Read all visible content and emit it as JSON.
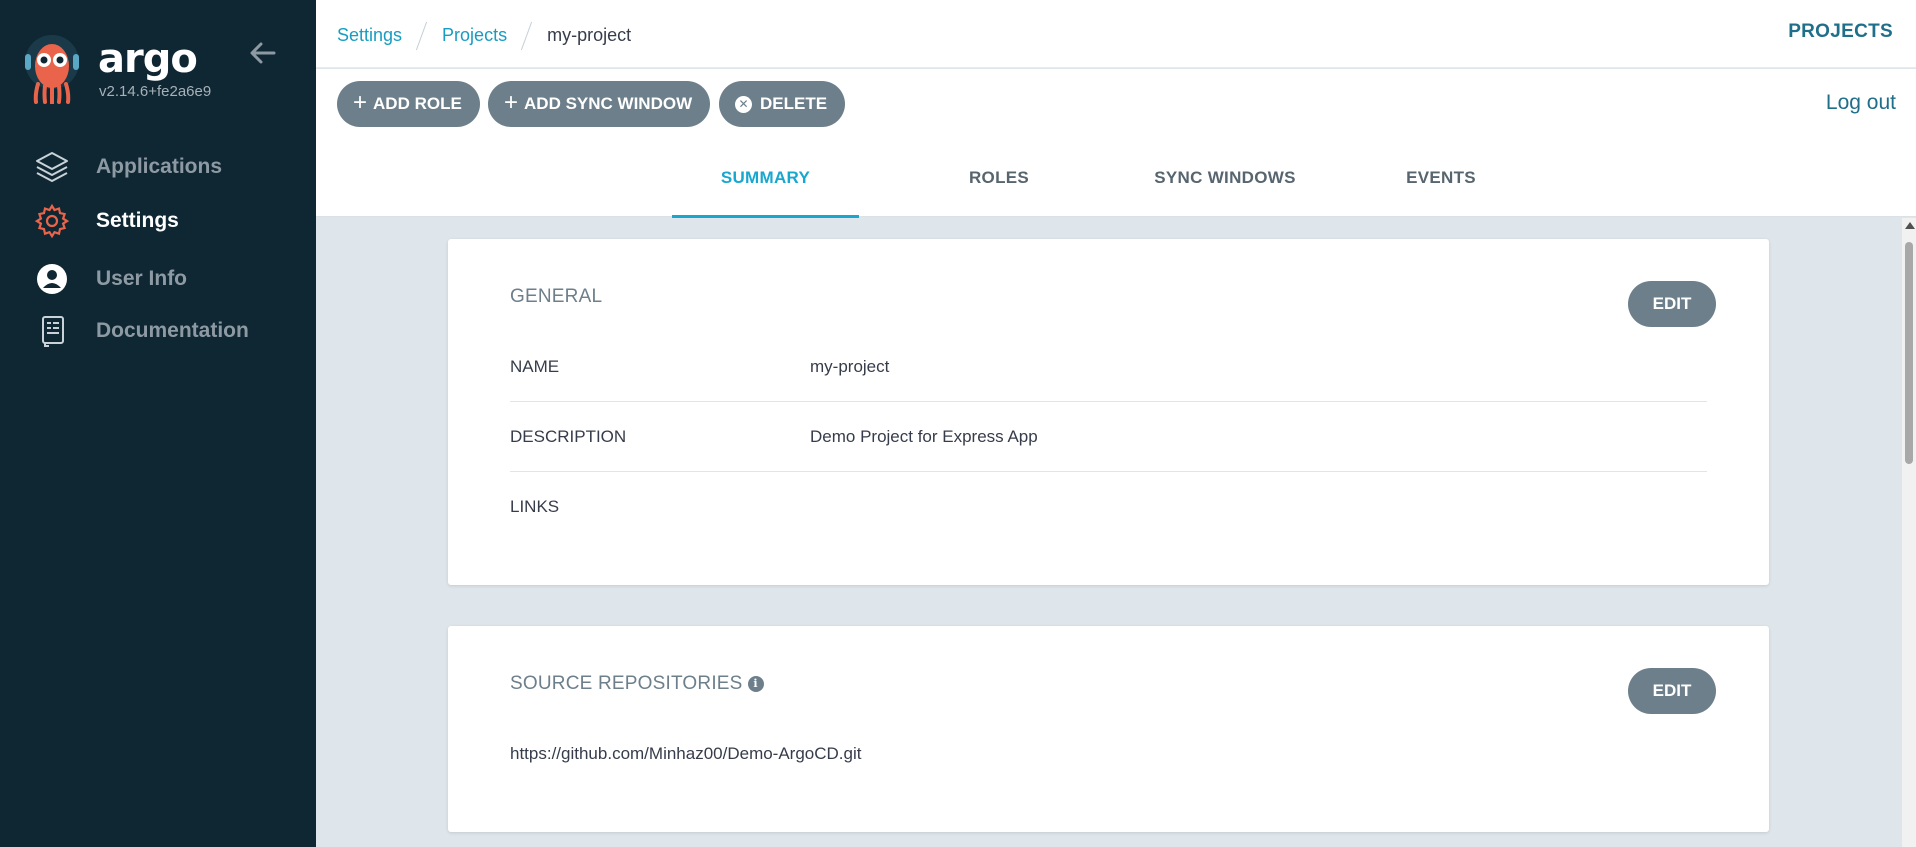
{
  "app": {
    "brand": "argo",
    "version": "v2.14.6+fe2a6e9"
  },
  "sidebar": {
    "items": [
      {
        "label": "Applications",
        "icon": "layers-icon"
      },
      {
        "label": "Settings",
        "icon": "gear-icon",
        "active": true
      },
      {
        "label": "User Info",
        "icon": "user-circle-icon"
      },
      {
        "label": "Documentation",
        "icon": "book-icon"
      }
    ]
  },
  "breadcrumb": {
    "items": [
      "Settings",
      "Projects"
    ],
    "current": "my-project"
  },
  "header": {
    "section": "PROJECTS",
    "logout": "Log out"
  },
  "toolbar": {
    "add_role": "ADD ROLE",
    "add_sync_window": "ADD SYNC WINDOW",
    "delete": "DELETE"
  },
  "tabs": [
    {
      "label": "SUMMARY",
      "active": true
    },
    {
      "label": "ROLES"
    },
    {
      "label": "SYNC WINDOWS"
    },
    {
      "label": "EVENTS"
    }
  ],
  "general": {
    "title": "GENERAL",
    "edit": "EDIT",
    "rows": [
      {
        "key": "NAME",
        "value": "my-project"
      },
      {
        "key": "DESCRIPTION",
        "value": "Demo Project for Express App"
      },
      {
        "key": "LINKS",
        "value": ""
      }
    ]
  },
  "source_repos": {
    "title": "SOURCE REPOSITORIES",
    "edit": "EDIT",
    "repos": [
      "https://github.com/Minhaz00/Demo-ArgoCD.git"
    ]
  },
  "colors": {
    "sidebar_bg": "#0f2733",
    "accent": "#18a7cf",
    "button_bg": "#6d7f8b",
    "content_bg": "#dee6eb",
    "settings_icon": "#e9644a"
  }
}
